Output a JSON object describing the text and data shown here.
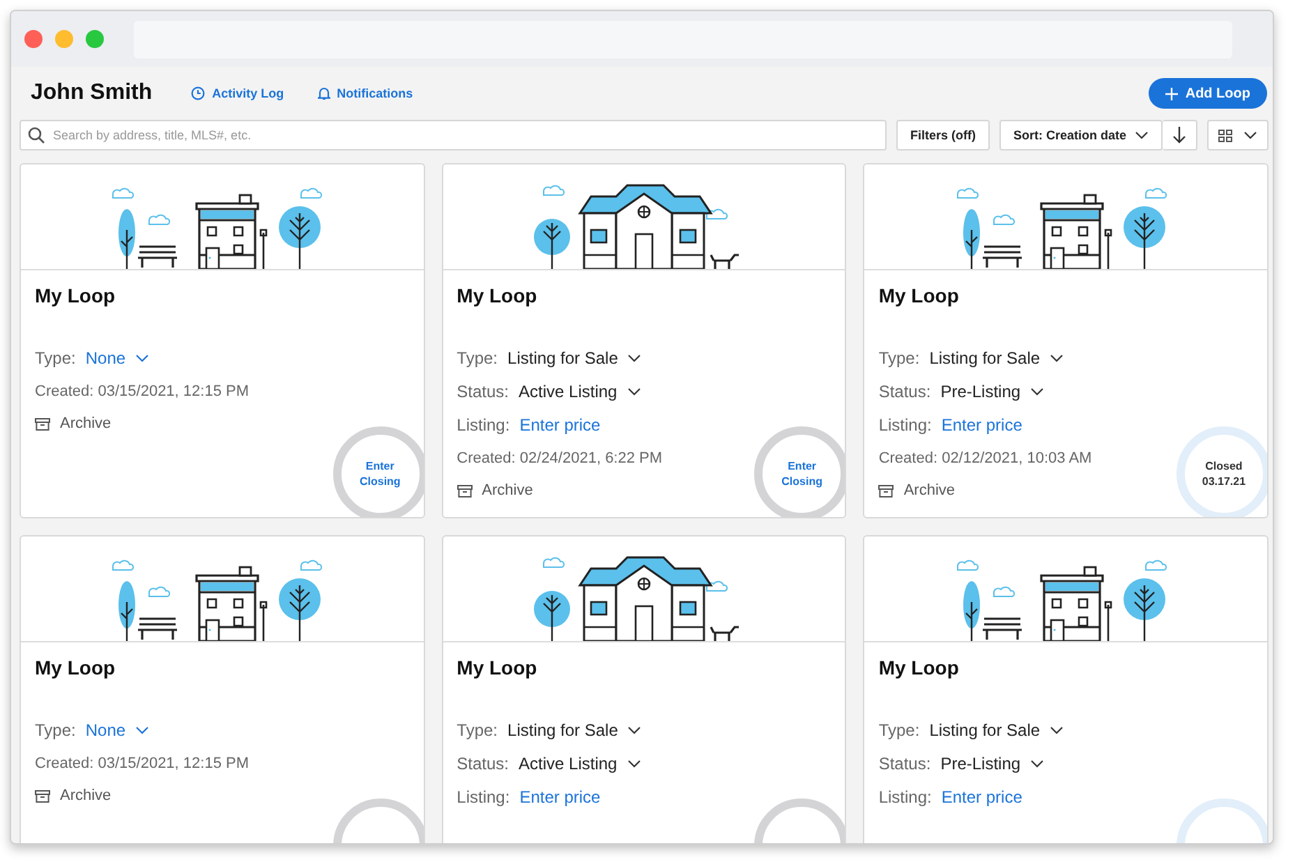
{
  "user": {
    "name": "John Smith"
  },
  "header_links": [
    {
      "kind": "activity",
      "label": "Activity Log"
    },
    {
      "kind": "notifications",
      "label": "Notifications"
    }
  ],
  "add_button": {
    "label": "Add Loop"
  },
  "search": {
    "placeholder": "Search by address, title, MLS#, etc."
  },
  "filters_button": {
    "label": "Filters (off)"
  },
  "sort": {
    "label": "Sort: Creation date"
  },
  "cards": [
    {
      "kind": "townhouse",
      "title": "My Loop",
      "fields": [
        {
          "label": "Type:",
          "value": "None",
          "kind": "link",
          "dropdown": true
        }
      ],
      "created": "Created: 03/15/2021, 12:15 PM",
      "archive": "Archive",
      "badge": {
        "kind": "open",
        "lines": [
          "Enter",
          "Closing"
        ]
      }
    },
    {
      "kind": "house",
      "title": "My Loop",
      "fields": [
        {
          "label": "Type:",
          "value": "Listing for Sale",
          "kind": "plain",
          "dropdown": true
        },
        {
          "label": "Status:",
          "value": "Active Listing",
          "kind": "plain",
          "dropdown": true
        },
        {
          "label": "Listing:",
          "value": "Enter price",
          "kind": "link",
          "dropdown": false
        }
      ],
      "created": "Created: 02/24/2021, 6:22 PM",
      "archive": "Archive",
      "badge": {
        "kind": "open",
        "lines": [
          "Enter",
          "Closing"
        ]
      }
    },
    {
      "kind": "townhouse",
      "title": "My Loop",
      "fields": [
        {
          "label": "Type:",
          "value": "Listing for Sale",
          "kind": "plain",
          "dropdown": true
        },
        {
          "label": "Status:",
          "value": "Pre-Listing",
          "kind": "plain",
          "dropdown": true
        },
        {
          "label": "Listing:",
          "value": "Enter price",
          "kind": "link",
          "dropdown": false
        }
      ],
      "created": "Created: 02/12/2021, 10:03 AM",
      "archive": "Archive",
      "badge": {
        "kind": "closed",
        "lines": [
          "Closed",
          "03.17.21"
        ]
      }
    },
    {
      "kind": "townhouse",
      "title": "My Loop",
      "fields": [
        {
          "label": "Type:",
          "value": "None",
          "kind": "link",
          "dropdown": true
        }
      ],
      "created": "Created: 03/15/2021, 12:15 PM",
      "archive": "Archive",
      "badge": {
        "kind": "open"
      }
    },
    {
      "kind": "house",
      "title": "My Loop",
      "fields": [
        {
          "label": "Type:",
          "value": "Listing for Sale",
          "kind": "plain",
          "dropdown": true
        },
        {
          "label": "Status:",
          "value": "Active Listing",
          "kind": "plain",
          "dropdown": true
        },
        {
          "label": "Listing:",
          "value": "Enter price",
          "kind": "link",
          "dropdown": false
        }
      ],
      "badge": {
        "kind": "open"
      }
    },
    {
      "kind": "townhouse",
      "title": "My Loop",
      "fields": [
        {
          "label": "Type:",
          "value": "Listing for Sale",
          "kind": "plain",
          "dropdown": true
        },
        {
          "label": "Status:",
          "value": "Pre-Listing",
          "kind": "plain",
          "dropdown": true
        },
        {
          "label": "Listing:",
          "value": "Enter price",
          "kind": "link",
          "dropdown": false
        }
      ],
      "badge": {
        "kind": "closed"
      }
    }
  ]
}
